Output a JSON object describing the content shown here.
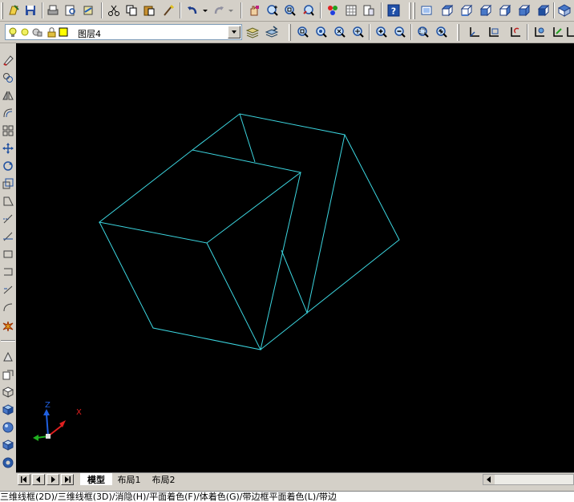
{
  "layer": {
    "name": "图层4"
  },
  "tabs": {
    "model": "模型",
    "layout1": "布局1",
    "layout2": "布局2"
  },
  "ucs": {
    "z_label": "Z",
    "x_label": "X"
  },
  "command_line": {
    "text": "三维线框(2D)/三维线框(3D)/消隐(H)/平面着色(F)/体着色(G)/带边框平面着色(L)/带边"
  },
  "colors": {
    "viewport_bg": "#000000",
    "wireframe": "#3cd6e0",
    "ucs_x": "#e02020",
    "ucs_y": "#20b020",
    "ucs_z": "#2060e0"
  },
  "icons": {
    "standard_toolbar": [
      "new-icon",
      "save-icon",
      "print-icon",
      "print-preview-icon",
      "publish-icon",
      "cut-icon",
      "copy-icon",
      "paste-icon",
      "match-properties-icon",
      "undo-icon",
      "redo-icon",
      "pan-icon",
      "zoom-realtime-icon",
      "zoom-window-icon",
      "zoom-previous-icon",
      "tool-palettes-icon",
      "design-center-icon",
      "properties-icon",
      "help-icon"
    ],
    "view_toolbar": [
      "named-views-icon",
      "top-view-icon",
      "bottom-view-icon",
      "left-view-icon",
      "right-view-icon",
      "front-view-icon",
      "sw-iso-icon"
    ]
  }
}
